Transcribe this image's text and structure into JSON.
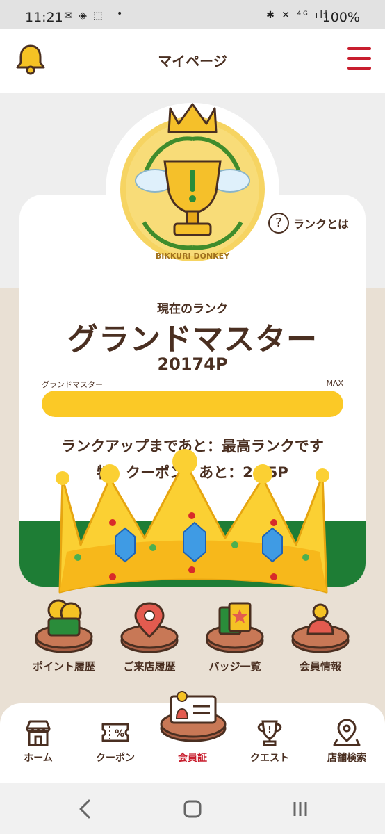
{
  "status_bar": {
    "time": "11:21",
    "notification_icons": "✉ ◈ ⬚",
    "dot": "•",
    "system_icons": "✱ ✕ ⁴ᴳ ıll",
    "battery": "100%"
  },
  "header": {
    "title": "マイページ",
    "accent_color": "#c81e2e"
  },
  "rank": {
    "help_icon": "?",
    "help_label": "ランクとは",
    "current_label": "現在のランク",
    "name": "グランドマスター",
    "points": "20174P",
    "bar_left_label": "グランドマスター",
    "bar_right_label": "MAX",
    "progress_fraction": 1.0,
    "up_text": "ランクアップまであと：最高ランクです",
    "coupon_text": "特　クーポン　あと：2　5P",
    "medal_text": "BIKKURI DONKEY"
  },
  "menu": [
    {
      "label": "ポイント履歴",
      "icon": "wallet-coins-icon"
    },
    {
      "label": "ご来店履歴",
      "icon": "location-pin-icon"
    },
    {
      "label": "バッジ一覧",
      "icon": "badge-cards-icon"
    },
    {
      "label": "会員情報",
      "icon": "user-icon"
    }
  ],
  "tabs": [
    {
      "label": "ホーム",
      "icon": "store-icon"
    },
    {
      "label": "クーポン",
      "icon": "coupon-icon"
    },
    {
      "label": "会員証",
      "icon": "member-card-icon",
      "active": true
    },
    {
      "label": "クエスト",
      "icon": "trophy-icon"
    },
    {
      "label": "店舗検索",
      "icon": "map-pin-icon"
    }
  ],
  "colors": {
    "brown": "#4a2f21",
    "gold": "#fbc926",
    "green": "#1e7d35",
    "red": "#c81e2e"
  }
}
